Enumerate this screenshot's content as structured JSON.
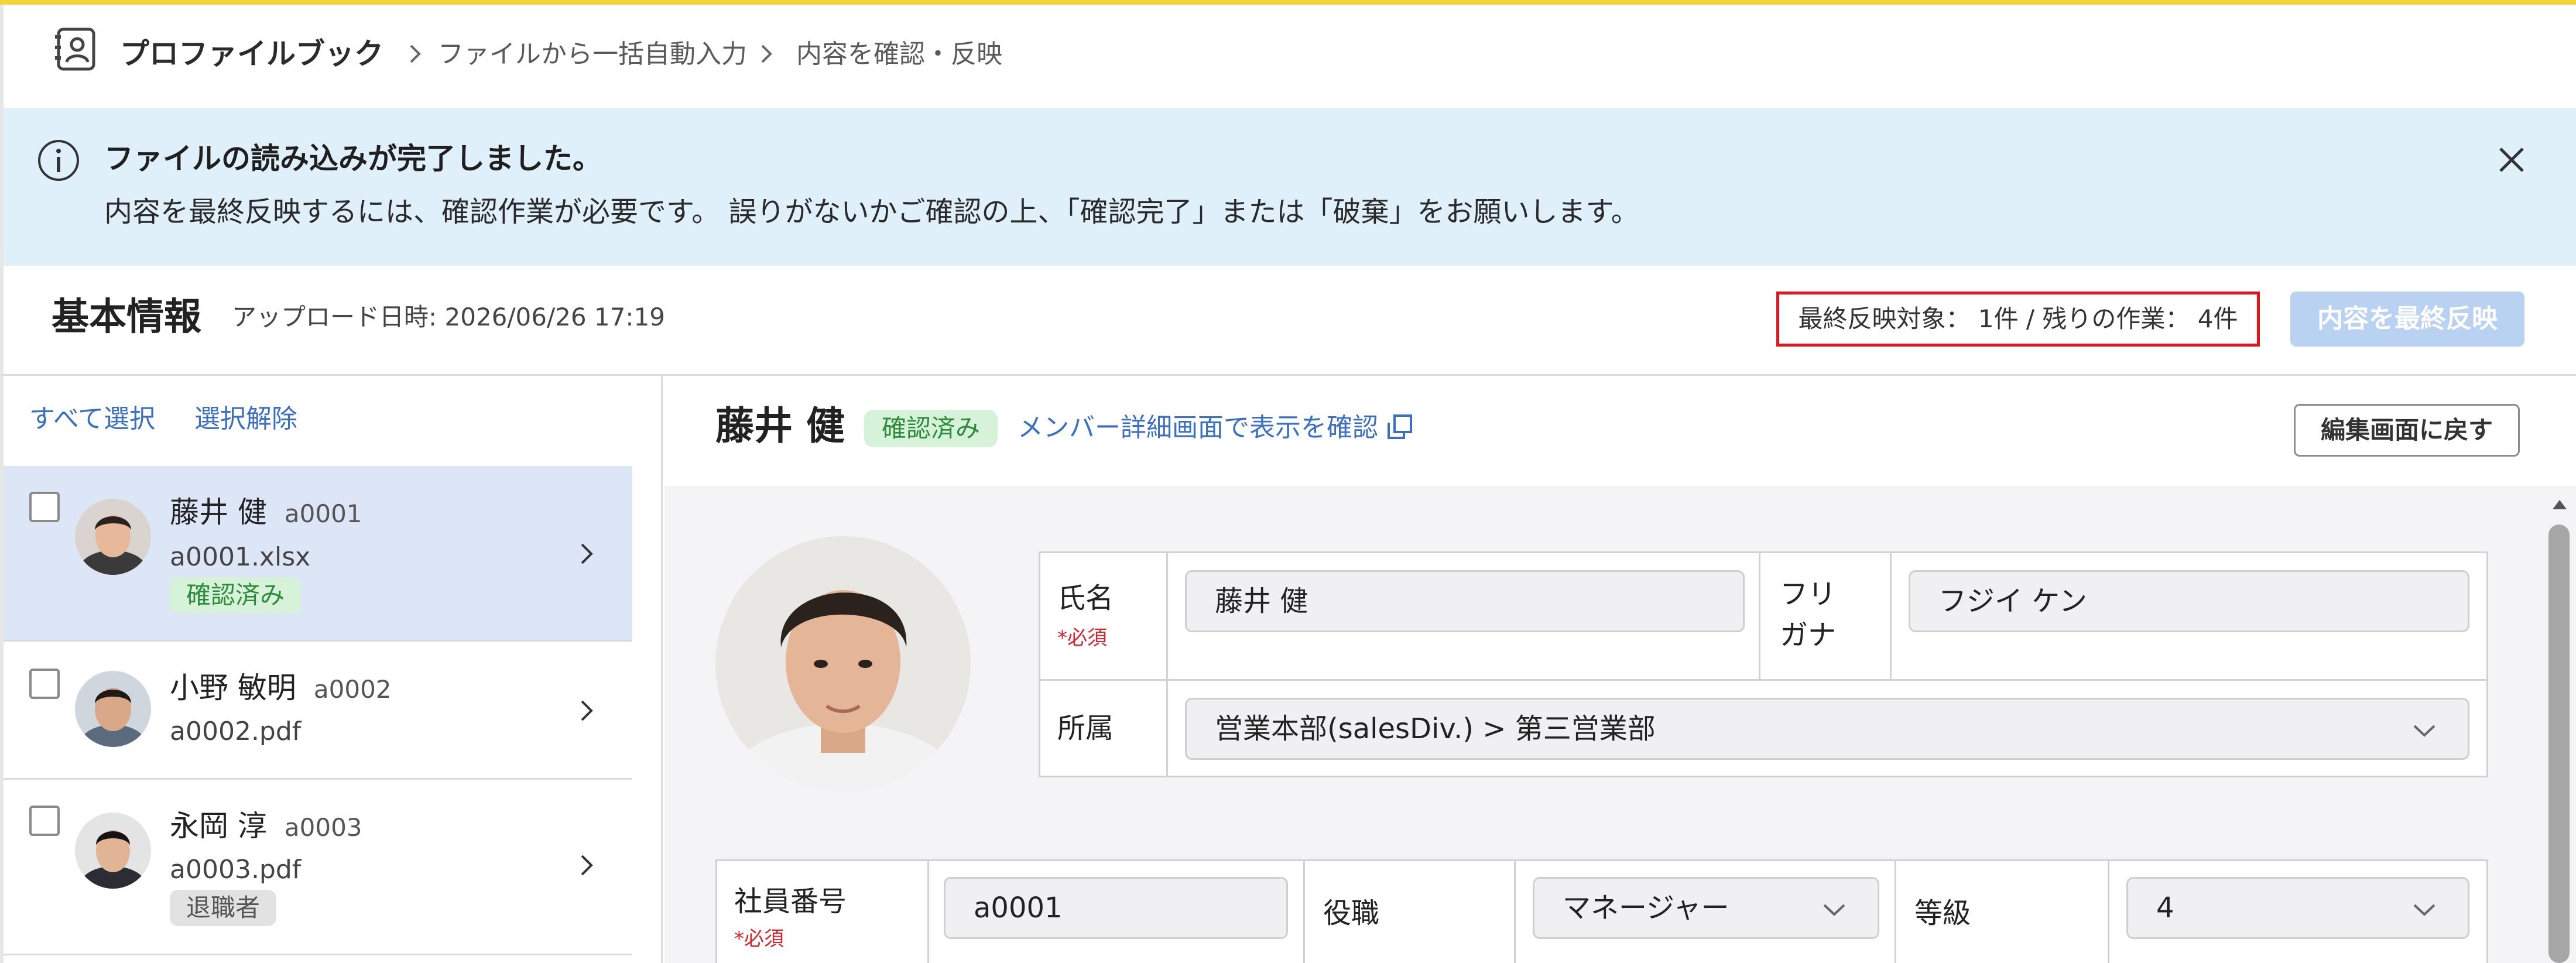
{
  "breadcrumb": {
    "app": "プロファイルブック",
    "step1": "ファイルから一括自動入力",
    "step2": "内容を確認・反映"
  },
  "banner": {
    "title": "ファイルの読み込みが完了しました。",
    "message": "内容を最終反映するには、確認作業が必要です。 誤りがないかご確認の上、「確認完了」または「破棄」をお願いします。"
  },
  "section": {
    "title": "基本情報",
    "upload_label": "アップロード日時: 2026/06/26 17:19",
    "status": "最終反映対象： 1件 / 残りの作業： 4件",
    "final_button": "内容を最終反映"
  },
  "list": {
    "select_all": "すべて選択",
    "deselect": "選択解除",
    "items": [
      {
        "name": "藤井 健",
        "code": "a0001",
        "file": "a0001.xlsx",
        "badge": "確認済み",
        "active": true
      },
      {
        "name": "小野 敏明",
        "code": "a0002",
        "file": "a0002.pdf",
        "badge": ""
      },
      {
        "name": "永岡 淳",
        "code": "a0003",
        "file": "a0003.pdf",
        "badge": "退職者"
      }
    ]
  },
  "detail": {
    "name": "藤井 健",
    "badge": "確認済み",
    "link": "メンバー詳細画面で表示を確認",
    "back_button": "編集画面に戻す",
    "fields": {
      "name_label": "氏名",
      "required": "*必須",
      "name_value": "藤井 健",
      "kana_label": "フリガナ",
      "kana_value": "フジイ ケン",
      "dept_label": "所属",
      "dept_value": "営業本部(salesDiv.) > 第三営業部",
      "emp_no_label": "社員番号",
      "emp_no_value": "a0001",
      "role_label": "役職",
      "role_value": "マネージャー",
      "grade_label": "等級",
      "grade_value": "4"
    }
  },
  "colors": {
    "accent_yellow": "#f2d536",
    "banner_bg": "#e0f0fb",
    "link_blue": "#3a6fc4",
    "required_red": "#d8252b",
    "status_border": "#e3151b",
    "badge_green": "#2e8a3d"
  }
}
